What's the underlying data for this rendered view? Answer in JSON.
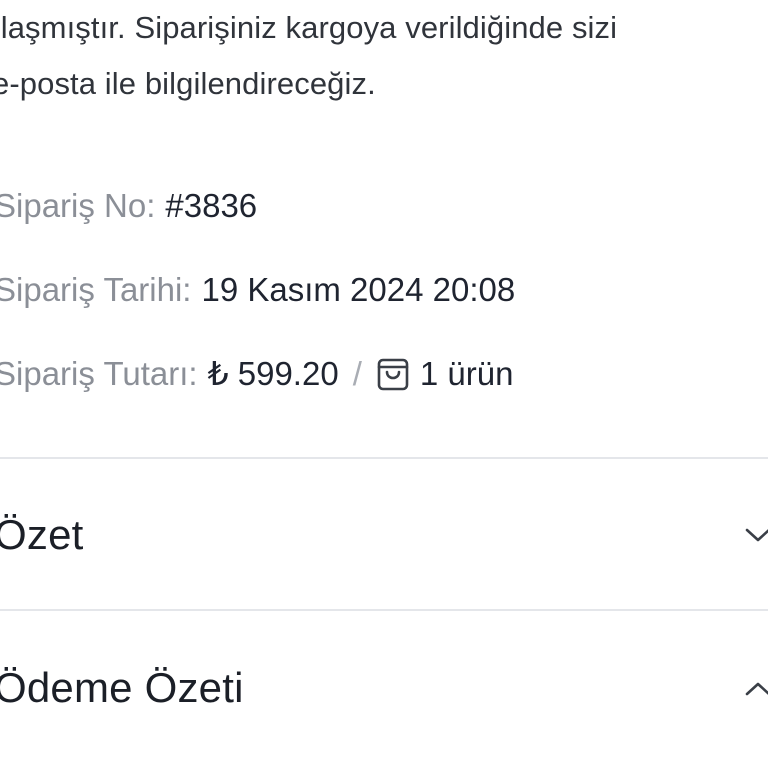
{
  "intro": {
    "line1": "ılaşmıştır. Siparişiniz kargoya verildiğinde sizi",
    "line2": "e-posta ile bilgilendireceğiz."
  },
  "order": {
    "number_label": "Sipariş No:",
    "number_value": "#3836",
    "date_label": "Sipariş Tarihi:",
    "date_value": "19 Kasım 2024 20:08",
    "total_label": "Sipariş Tutarı:",
    "total_value": "₺ 599.20",
    "separator": "/",
    "items_value": "1 ürün"
  },
  "sections": {
    "summary": {
      "title": "Özet",
      "expanded": false
    },
    "payment_summary": {
      "title": "Ödeme Özeti",
      "expanded": true
    }
  },
  "icons": {
    "items": "shopping-bag-icon",
    "summary_toggle": "chevron-down-icon",
    "payment_toggle": "chevron-up-icon"
  },
  "colors": {
    "text_primary": "#1f2430",
    "text_secondary": "#8b8f97",
    "divider": "#e4e6ea",
    "background": "#ffffff"
  }
}
